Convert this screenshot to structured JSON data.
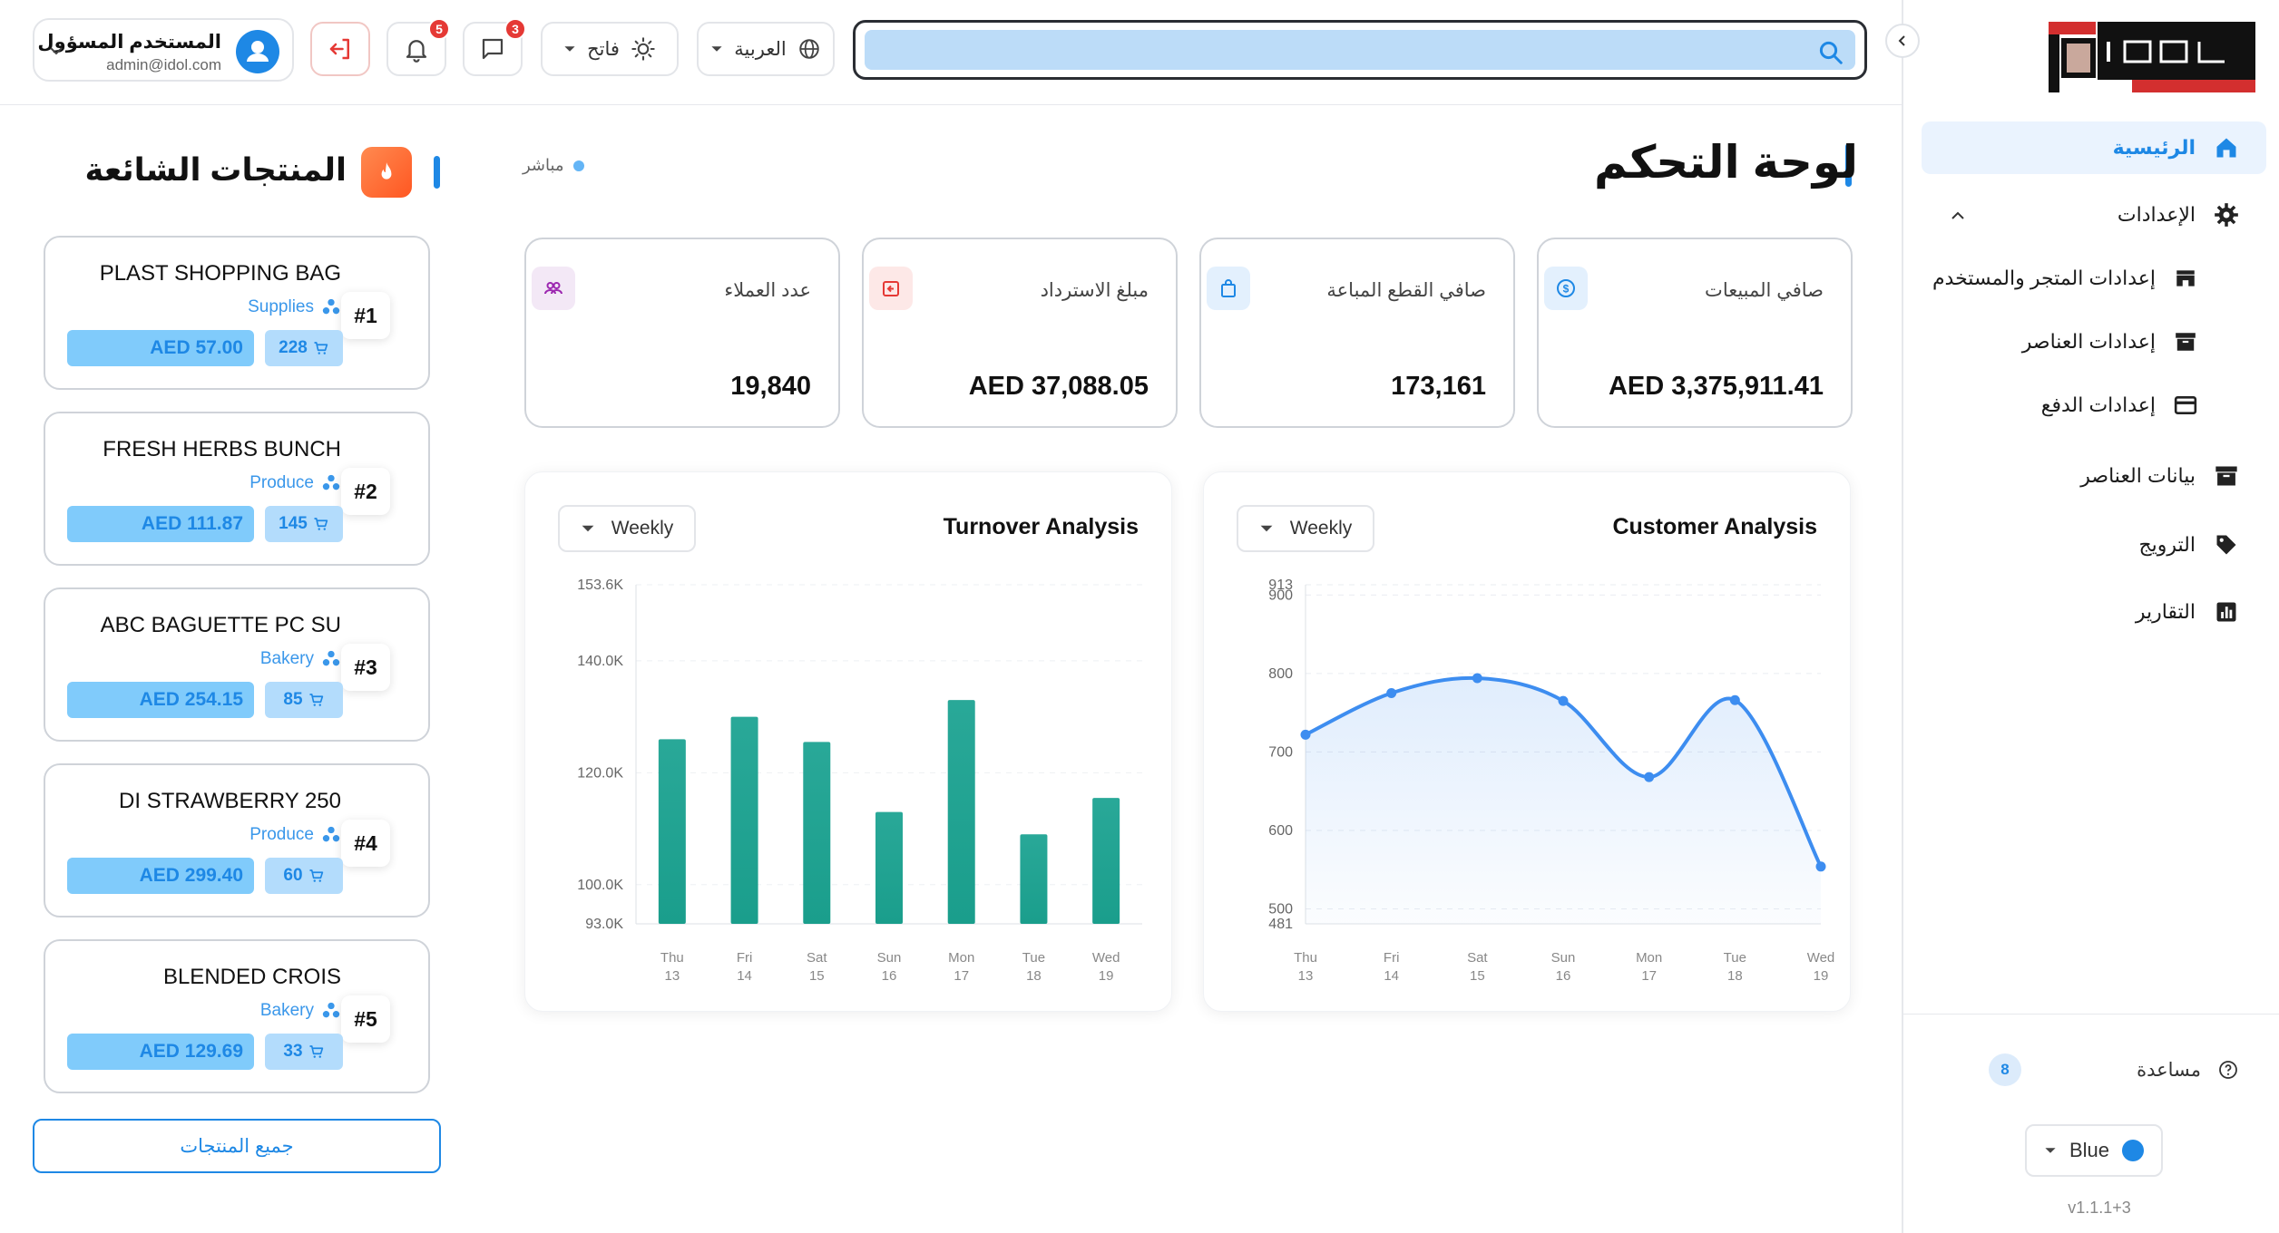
{
  "header": {
    "search": {
      "placeholder": "",
      "value": ""
    },
    "language": "العربية",
    "theme": "فاتح",
    "messages_count": "3",
    "notifications_count": "5",
    "user": {
      "name": "المستخدم المسؤول",
      "email": "admin@idol.com"
    }
  },
  "sidebar": {
    "nav": [
      {
        "label": "الرئيسية",
        "icon": "home-icon",
        "active": true
      },
      {
        "label": "الإعدادات",
        "icon": "gear-icon",
        "expanded": true
      },
      {
        "label": "إعدادات المتجر والمستخدم",
        "icon": "store-icon",
        "sub": true
      },
      {
        "label": "إعدادات العناصر",
        "icon": "archive-icon",
        "sub": true
      },
      {
        "label": "إعدادات الدفع",
        "icon": "credit-card-icon",
        "sub": true
      },
      {
        "label": "بيانات العناصر",
        "icon": "archive-icon"
      },
      {
        "label": "الترويج",
        "icon": "tag-icon"
      },
      {
        "label": "التقارير",
        "icon": "bar-chart-icon"
      }
    ],
    "help_label": "مساعدة",
    "help_count": "8",
    "color_theme": "Blue",
    "version": "v1.1.1+3"
  },
  "main": {
    "title": "لوحة التحكم",
    "live_label": "مباشر",
    "stats": [
      {
        "label": "صافي المبيعات",
        "value": "AED 3,375,911.41",
        "icon": "dollar-icon",
        "color": "#1e88e5"
      },
      {
        "label": "صافي القطع المباعة",
        "value": "173,161",
        "icon": "shopping-bag-icon",
        "color": "#1e88e5"
      },
      {
        "label": "مبلغ الاسترداد",
        "value": "AED 37,088.05",
        "icon": "refund-icon",
        "color": "#e53935"
      },
      {
        "label": "عدد العملاء",
        "value": "19,840",
        "icon": "people-icon",
        "color": "#9c27b0"
      }
    ]
  },
  "charts": {
    "customer": {
      "title": "Customer Analysis",
      "period": "Weekly"
    },
    "turnover": {
      "title": "Turnover Analysis",
      "period": "Weekly"
    }
  },
  "chart_data": [
    {
      "type": "area",
      "title": "Customer Analysis",
      "x": [
        "Thu 13",
        "Fri 14",
        "Sat 15",
        "Sun 16",
        "Mon 17",
        "Tue 18",
        "Wed 19"
      ],
      "values": [
        722,
        775,
        794,
        765,
        668,
        766,
        554
      ],
      "yticks": [
        481,
        500,
        600,
        700,
        800,
        900,
        913
      ],
      "ylim": [
        481,
        913
      ],
      "color": "#3d8df0"
    },
    {
      "type": "bar",
      "title": "Turnover Analysis",
      "categories": [
        "Thu 13",
        "Fri 14",
        "Sat 15",
        "Sun 16",
        "Mon 17",
        "Tue 18",
        "Wed 19"
      ],
      "values": [
        126000,
        130000,
        125500,
        113000,
        133000,
        109000,
        115500
      ],
      "yticks": [
        "93.0K",
        "100.0K",
        "120.0K",
        "140.0K",
        "153.6K"
      ],
      "ytick_values": [
        93000,
        100000,
        120000,
        140000,
        153600
      ],
      "ylim": [
        93000,
        153600
      ],
      "color": "#1a9e8c"
    }
  ],
  "popular": {
    "title": "المنتجات الشائعة",
    "all_label": "جميع المنتجات",
    "items": [
      {
        "rank": "#1",
        "name": "PLAST SHOPPING BAG",
        "category": "Supplies",
        "price": "AED 57.00",
        "qty": "228"
      },
      {
        "rank": "#2",
        "name": "FRESH HERBS BUNCH",
        "category": "Produce",
        "price": "AED 111.87",
        "qty": "145"
      },
      {
        "rank": "#3",
        "name": "ABC BAGUETTE PC SU",
        "category": "Bakery",
        "price": "AED 254.15",
        "qty": "85"
      },
      {
        "rank": "#4",
        "name": "DI STRAWBERRY 250",
        "category": "Produce",
        "price": "AED 299.40",
        "qty": "60"
      },
      {
        "rank": "#5",
        "name": "BLENDED CROIS",
        "category": "Bakery",
        "price": "AED 129.69",
        "qty": "33"
      }
    ]
  }
}
